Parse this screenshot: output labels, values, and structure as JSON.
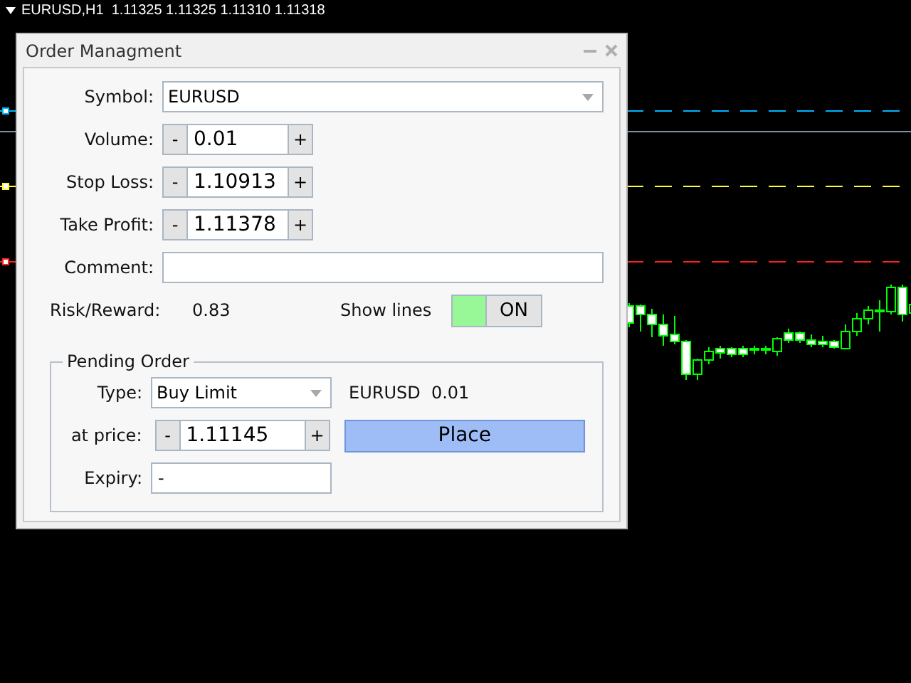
{
  "chart": {
    "header": "EURUSD,H1  1.11325 1.11325 1.11310 1.11318"
  },
  "dialog": {
    "title": "Order Managment",
    "symbol": {
      "label": "Symbol:",
      "value": "EURUSD"
    },
    "steppers": [
      {
        "label": "Volume:",
        "value": "0.01",
        "minus": "-",
        "plus": "+"
      },
      {
        "label": "Stop Loss:",
        "value": "1.10913",
        "minus": "-",
        "plus": "+"
      },
      {
        "label": "Take Profit:",
        "value": "1.11378",
        "minus": "-",
        "plus": "+"
      }
    ],
    "comment": {
      "label": "Comment:"
    },
    "risk_reward": {
      "label": "Risk/Reward:",
      "value": "0.83"
    },
    "show_lines": {
      "label": "Show lines",
      "on": true,
      "state_text": "ON"
    },
    "pending_order": {
      "legend": "Pending Order",
      "type": {
        "label": "Type:",
        "value": "Buy Limit"
      },
      "summary": "EURUSD  0.01",
      "price": {
        "label": "at price:",
        "value": "1.11145",
        "minus": "-",
        "plus": "+"
      },
      "place_button": "Place",
      "expiry": {
        "label": "Expiry:",
        "value": "-"
      }
    }
  }
}
